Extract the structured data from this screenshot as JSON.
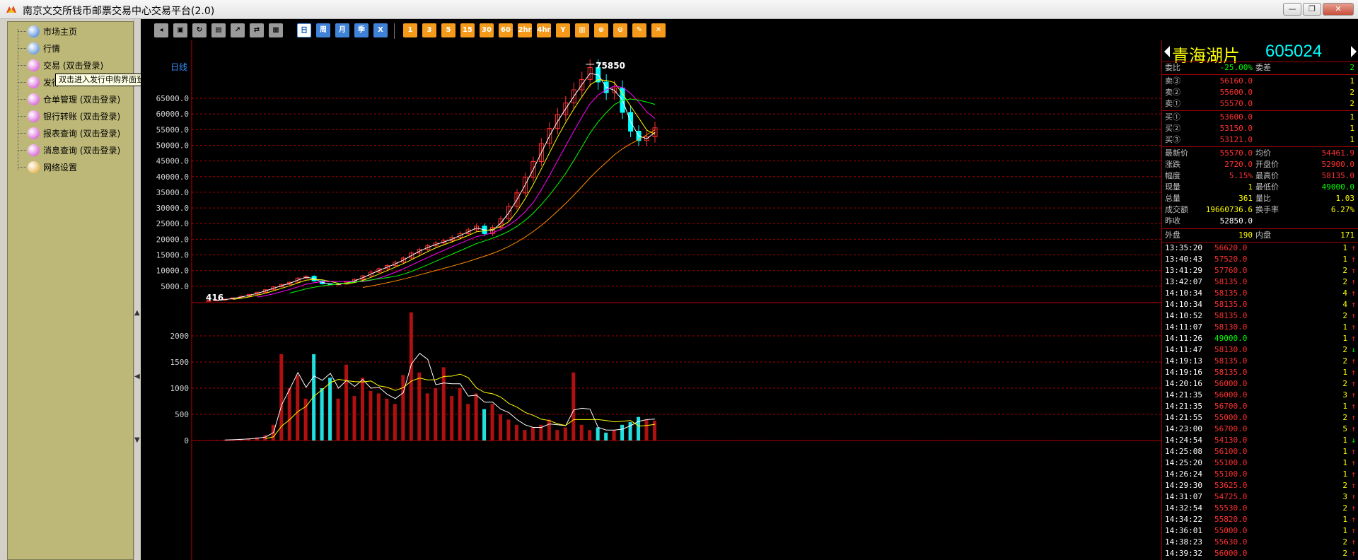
{
  "window": {
    "title": "南京文交所钱币邮票交易中心交易平台(2.0)",
    "buttons": [
      "—",
      "❐",
      "✕"
    ]
  },
  "sidebar": {
    "items": [
      {
        "label": "市场主页",
        "icon": "globe-icon",
        "color": "#2a6fd6"
      },
      {
        "label": "行情",
        "icon": "person-icon",
        "color": "#3a7ad0"
      },
      {
        "label": "交易 (双击登录)",
        "icon": "globe-icon",
        "color": "#d03ad0"
      },
      {
        "label": "发行",
        "icon": "globe-icon",
        "color": "#d03ad0"
      },
      {
        "label": "仓单管理 (双击登录)",
        "icon": "globe-icon",
        "color": "#d03ad0"
      },
      {
        "label": "银行转账 (双击登录)",
        "icon": "globe-icon",
        "color": "#d03ad0"
      },
      {
        "label": "报表查询 (双击登录)",
        "icon": "globe-icon",
        "color": "#d03ad0"
      },
      {
        "label": "消息查询 (双击登录)",
        "icon": "globe-icon",
        "color": "#d03ad0"
      },
      {
        "label": "网络设置",
        "icon": "network-icon",
        "color": "#e0a020"
      }
    ],
    "tooltip": "双击进入发行申购界面登录界面(发行设申购版本："
  },
  "toolbar": {
    "period_buttons": [
      "日",
      "周",
      "月",
      "季",
      "X"
    ],
    "minute_buttons": [
      "1",
      "3",
      "5",
      "15",
      "30",
      "60",
      "2hr",
      "4hr"
    ]
  },
  "chart_data": [
    {
      "type": "candlestick",
      "title": "日线",
      "yticks": [
        "65000.0",
        "60000.0",
        "55000.0",
        "50000.0",
        "45000.0",
        "40000.0",
        "35000.0",
        "30000.0",
        "25000.0",
        "20000.0",
        "15000.0",
        "10000.0",
        "5000.0"
      ],
      "ylim": [
        0,
        75850
      ],
      "high_label": "75850",
      "low_label": "416",
      "close_series": [
        416,
        600,
        900,
        1300,
        1800,
        2400,
        3100,
        3900,
        4800,
        5600,
        6300,
        7600,
        8200,
        6700,
        5800,
        5500,
        5700,
        6300,
        7200,
        8300,
        9500,
        10600,
        11600,
        12700,
        14000,
        15600,
        16800,
        17900,
        18800,
        19500,
        20600,
        21800,
        23000,
        24200,
        21800,
        23800,
        26500,
        30500,
        34800,
        39800,
        44800,
        50500,
        55400,
        59800,
        63500,
        67700,
        71000,
        74800,
        70200,
        66800,
        68300,
        60500,
        54500,
        51500,
        52700,
        55570
      ],
      "ma_lines": [
        {
          "color": "#ffffff"
        },
        {
          "color": "#ffff00"
        },
        {
          "color": "#ff00ff"
        },
        {
          "color": "#00ff00"
        },
        {
          "color": "#ff8c00"
        }
      ]
    },
    {
      "type": "bar",
      "title": "volume",
      "yticks": [
        "2000",
        "1500",
        "1000",
        "500",
        "0"
      ],
      "ylim": [
        0,
        2500
      ],
      "values": [
        5,
        10,
        15,
        20,
        30,
        40,
        60,
        100,
        300,
        1650,
        1000,
        1250,
        800,
        1650,
        1000,
        1200,
        800,
        1450,
        850,
        1200,
        950,
        900,
        800,
        700,
        1250,
        2450,
        1300,
        900,
        1000,
        1400,
        850,
        1000,
        700,
        900,
        600,
        700,
        500,
        400,
        300,
        200,
        250,
        300,
        400,
        200,
        250,
        1300,
        300,
        200,
        250,
        150,
        200,
        300,
        350,
        450,
        400,
        380
      ]
    }
  ],
  "quote": {
    "name": "青海湖片",
    "code": "605024",
    "weibi": {
      "label": "委比",
      "value": "-25.00%",
      "label2": "委差",
      "value2": "2"
    },
    "sell": [
      {
        "label": "卖③",
        "price": "56160.0",
        "vol": "1"
      },
      {
        "label": "卖②",
        "price": "55600.0",
        "vol": "2"
      },
      {
        "label": "卖①",
        "price": "55570.0",
        "vol": "2"
      }
    ],
    "buy": [
      {
        "label": "买①",
        "price": "53600.0",
        "vol": "1"
      },
      {
        "label": "买②",
        "price": "53150.0",
        "vol": "1"
      },
      {
        "label": "买③",
        "price": "53121.0",
        "vol": "1"
      }
    ],
    "stats": [
      {
        "l1": "最新价",
        "v1": "55570.0",
        "c1": "red",
        "l2": "均价",
        "v2": "54461.9",
        "c2": "red"
      },
      {
        "l1": "涨跌",
        "v1": "2720.0",
        "c1": "red",
        "l2": "开盘价",
        "v2": "52900.0",
        "c2": "red"
      },
      {
        "l1": "幅度",
        "v1": "5.15%",
        "c1": "red",
        "l2": "最高价",
        "v2": "58135.0",
        "c2": "red"
      },
      {
        "l1": "现量",
        "v1": "1",
        "c1": "yellow",
        "l2": "最低价",
        "v2": "49000.0",
        "c2": "green"
      },
      {
        "l1": "总量",
        "v1": "361",
        "c1": "yellow",
        "l2": "量比",
        "v2": "1.03",
        "c2": "yellow"
      },
      {
        "l1": "成交额",
        "v1": "19660736.6",
        "c1": "yellow",
        "l2": "换手率",
        "v2": "6.27%",
        "c2": "yellow"
      },
      {
        "l1": "昨收",
        "v1": "52850.0",
        "c1": "white",
        "l2": "",
        "v2": "",
        "c2": "white"
      }
    ],
    "outer": {
      "label": "外盘",
      "value": "190",
      "label2": "内盘",
      "value2": "171"
    },
    "ticks": [
      {
        "t": "13:35:20",
        "p": "56620.0",
        "c": "red",
        "v": "1",
        "a": "↑"
      },
      {
        "t": "13:40:43",
        "p": "57520.0",
        "c": "red",
        "v": "1",
        "a": "↑"
      },
      {
        "t": "13:41:29",
        "p": "57760.0",
        "c": "red",
        "v": "2",
        "a": "↑"
      },
      {
        "t": "13:42:07",
        "p": "58135.0",
        "c": "red",
        "v": "2",
        "a": "↑"
      },
      {
        "t": "14:10:34",
        "p": "58135.0",
        "c": "red",
        "v": "4",
        "a": "↑"
      },
      {
        "t": "14:10:34",
        "p": "58135.0",
        "c": "red",
        "v": "4",
        "a": "↑"
      },
      {
        "t": "14:10:52",
        "p": "58135.0",
        "c": "red",
        "v": "2",
        "a": "↑"
      },
      {
        "t": "14:11:07",
        "p": "58130.0",
        "c": "red",
        "v": "1",
        "a": "↑"
      },
      {
        "t": "14:11:26",
        "p": "49000.0",
        "c": "green",
        "v": "1",
        "a": "↑"
      },
      {
        "t": "14:11:47",
        "p": "58130.0",
        "c": "red",
        "v": "2",
        "a": "↓"
      },
      {
        "t": "14:19:13",
        "p": "58135.0",
        "c": "red",
        "v": "2",
        "a": "↑"
      },
      {
        "t": "14:19:16",
        "p": "58135.0",
        "c": "red",
        "v": "1",
        "a": "↑"
      },
      {
        "t": "14:20:16",
        "p": "56000.0",
        "c": "red",
        "v": "2",
        "a": "↑"
      },
      {
        "t": "14:21:35",
        "p": "56000.0",
        "c": "red",
        "v": "3",
        "a": "↑"
      },
      {
        "t": "14:21:35",
        "p": "56700.0",
        "c": "red",
        "v": "1",
        "a": "↑"
      },
      {
        "t": "14:21:55",
        "p": "55000.0",
        "c": "red",
        "v": "2",
        "a": "↑"
      },
      {
        "t": "14:23:00",
        "p": "56700.0",
        "c": "red",
        "v": "5",
        "a": "↑"
      },
      {
        "t": "14:24:54",
        "p": "54130.0",
        "c": "red",
        "v": "1",
        "a": "↓"
      },
      {
        "t": "14:25:08",
        "p": "56100.0",
        "c": "red",
        "v": "1",
        "a": "↑"
      },
      {
        "t": "14:25:20",
        "p": "55100.0",
        "c": "red",
        "v": "1",
        "a": "↑"
      },
      {
        "t": "14:26:24",
        "p": "55100.0",
        "c": "red",
        "v": "1",
        "a": "↑"
      },
      {
        "t": "14:29:30",
        "p": "53625.0",
        "c": "red",
        "v": "2",
        "a": "↑"
      },
      {
        "t": "14:31:07",
        "p": "54725.0",
        "c": "red",
        "v": "3",
        "a": "↑"
      },
      {
        "t": "14:32:54",
        "p": "55530.0",
        "c": "red",
        "v": "2",
        "a": "↑"
      },
      {
        "t": "14:34:22",
        "p": "55820.0",
        "c": "red",
        "v": "1",
        "a": "↑"
      },
      {
        "t": "14:36:01",
        "p": "55000.0",
        "c": "red",
        "v": "1",
        "a": "↑"
      },
      {
        "t": "14:38:23",
        "p": "55630.0",
        "c": "red",
        "v": "2",
        "a": "↑"
      },
      {
        "t": "14:39:32",
        "p": "56000.0",
        "c": "red",
        "v": "2",
        "a": "↑"
      }
    ]
  }
}
